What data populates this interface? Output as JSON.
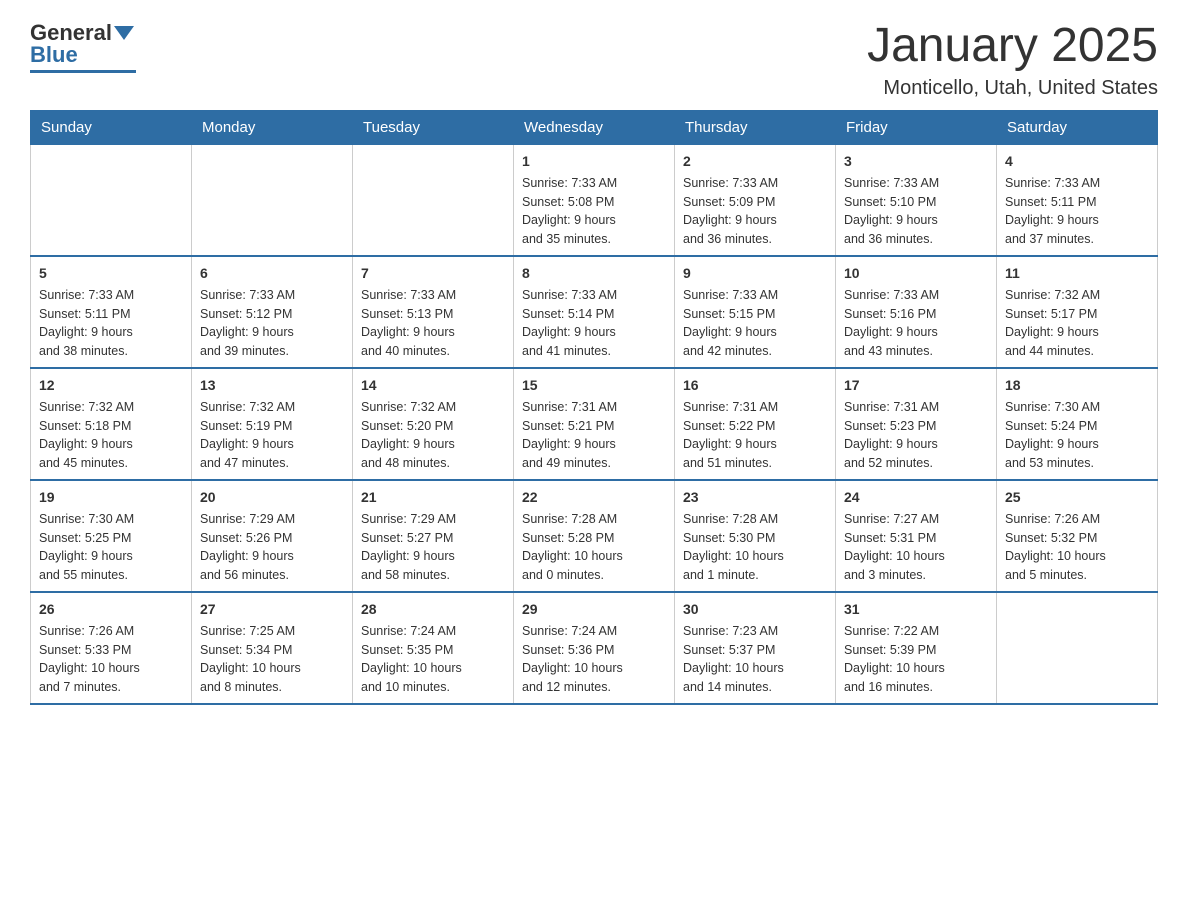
{
  "header": {
    "logo": {
      "general": "General",
      "blue": "Blue"
    },
    "title": "January 2025",
    "subtitle": "Monticello, Utah, United States"
  },
  "weekdays": [
    "Sunday",
    "Monday",
    "Tuesday",
    "Wednesday",
    "Thursday",
    "Friday",
    "Saturday"
  ],
  "weeks": [
    [
      {
        "day": "",
        "info": ""
      },
      {
        "day": "",
        "info": ""
      },
      {
        "day": "",
        "info": ""
      },
      {
        "day": "1",
        "info": "Sunrise: 7:33 AM\nSunset: 5:08 PM\nDaylight: 9 hours\nand 35 minutes."
      },
      {
        "day": "2",
        "info": "Sunrise: 7:33 AM\nSunset: 5:09 PM\nDaylight: 9 hours\nand 36 minutes."
      },
      {
        "day": "3",
        "info": "Sunrise: 7:33 AM\nSunset: 5:10 PM\nDaylight: 9 hours\nand 36 minutes."
      },
      {
        "day": "4",
        "info": "Sunrise: 7:33 AM\nSunset: 5:11 PM\nDaylight: 9 hours\nand 37 minutes."
      }
    ],
    [
      {
        "day": "5",
        "info": "Sunrise: 7:33 AM\nSunset: 5:11 PM\nDaylight: 9 hours\nand 38 minutes."
      },
      {
        "day": "6",
        "info": "Sunrise: 7:33 AM\nSunset: 5:12 PM\nDaylight: 9 hours\nand 39 minutes."
      },
      {
        "day": "7",
        "info": "Sunrise: 7:33 AM\nSunset: 5:13 PM\nDaylight: 9 hours\nand 40 minutes."
      },
      {
        "day": "8",
        "info": "Sunrise: 7:33 AM\nSunset: 5:14 PM\nDaylight: 9 hours\nand 41 minutes."
      },
      {
        "day": "9",
        "info": "Sunrise: 7:33 AM\nSunset: 5:15 PM\nDaylight: 9 hours\nand 42 minutes."
      },
      {
        "day": "10",
        "info": "Sunrise: 7:33 AM\nSunset: 5:16 PM\nDaylight: 9 hours\nand 43 minutes."
      },
      {
        "day": "11",
        "info": "Sunrise: 7:32 AM\nSunset: 5:17 PM\nDaylight: 9 hours\nand 44 minutes."
      }
    ],
    [
      {
        "day": "12",
        "info": "Sunrise: 7:32 AM\nSunset: 5:18 PM\nDaylight: 9 hours\nand 45 minutes."
      },
      {
        "day": "13",
        "info": "Sunrise: 7:32 AM\nSunset: 5:19 PM\nDaylight: 9 hours\nand 47 minutes."
      },
      {
        "day": "14",
        "info": "Sunrise: 7:32 AM\nSunset: 5:20 PM\nDaylight: 9 hours\nand 48 minutes."
      },
      {
        "day": "15",
        "info": "Sunrise: 7:31 AM\nSunset: 5:21 PM\nDaylight: 9 hours\nand 49 minutes."
      },
      {
        "day": "16",
        "info": "Sunrise: 7:31 AM\nSunset: 5:22 PM\nDaylight: 9 hours\nand 51 minutes."
      },
      {
        "day": "17",
        "info": "Sunrise: 7:31 AM\nSunset: 5:23 PM\nDaylight: 9 hours\nand 52 minutes."
      },
      {
        "day": "18",
        "info": "Sunrise: 7:30 AM\nSunset: 5:24 PM\nDaylight: 9 hours\nand 53 minutes."
      }
    ],
    [
      {
        "day": "19",
        "info": "Sunrise: 7:30 AM\nSunset: 5:25 PM\nDaylight: 9 hours\nand 55 minutes."
      },
      {
        "day": "20",
        "info": "Sunrise: 7:29 AM\nSunset: 5:26 PM\nDaylight: 9 hours\nand 56 minutes."
      },
      {
        "day": "21",
        "info": "Sunrise: 7:29 AM\nSunset: 5:27 PM\nDaylight: 9 hours\nand 58 minutes."
      },
      {
        "day": "22",
        "info": "Sunrise: 7:28 AM\nSunset: 5:28 PM\nDaylight: 10 hours\nand 0 minutes."
      },
      {
        "day": "23",
        "info": "Sunrise: 7:28 AM\nSunset: 5:30 PM\nDaylight: 10 hours\nand 1 minute."
      },
      {
        "day": "24",
        "info": "Sunrise: 7:27 AM\nSunset: 5:31 PM\nDaylight: 10 hours\nand 3 minutes."
      },
      {
        "day": "25",
        "info": "Sunrise: 7:26 AM\nSunset: 5:32 PM\nDaylight: 10 hours\nand 5 minutes."
      }
    ],
    [
      {
        "day": "26",
        "info": "Sunrise: 7:26 AM\nSunset: 5:33 PM\nDaylight: 10 hours\nand 7 minutes."
      },
      {
        "day": "27",
        "info": "Sunrise: 7:25 AM\nSunset: 5:34 PM\nDaylight: 10 hours\nand 8 minutes."
      },
      {
        "day": "28",
        "info": "Sunrise: 7:24 AM\nSunset: 5:35 PM\nDaylight: 10 hours\nand 10 minutes."
      },
      {
        "day": "29",
        "info": "Sunrise: 7:24 AM\nSunset: 5:36 PM\nDaylight: 10 hours\nand 12 minutes."
      },
      {
        "day": "30",
        "info": "Sunrise: 7:23 AM\nSunset: 5:37 PM\nDaylight: 10 hours\nand 14 minutes."
      },
      {
        "day": "31",
        "info": "Sunrise: 7:22 AM\nSunset: 5:39 PM\nDaylight: 10 hours\nand 16 minutes."
      },
      {
        "day": "",
        "info": ""
      }
    ]
  ]
}
